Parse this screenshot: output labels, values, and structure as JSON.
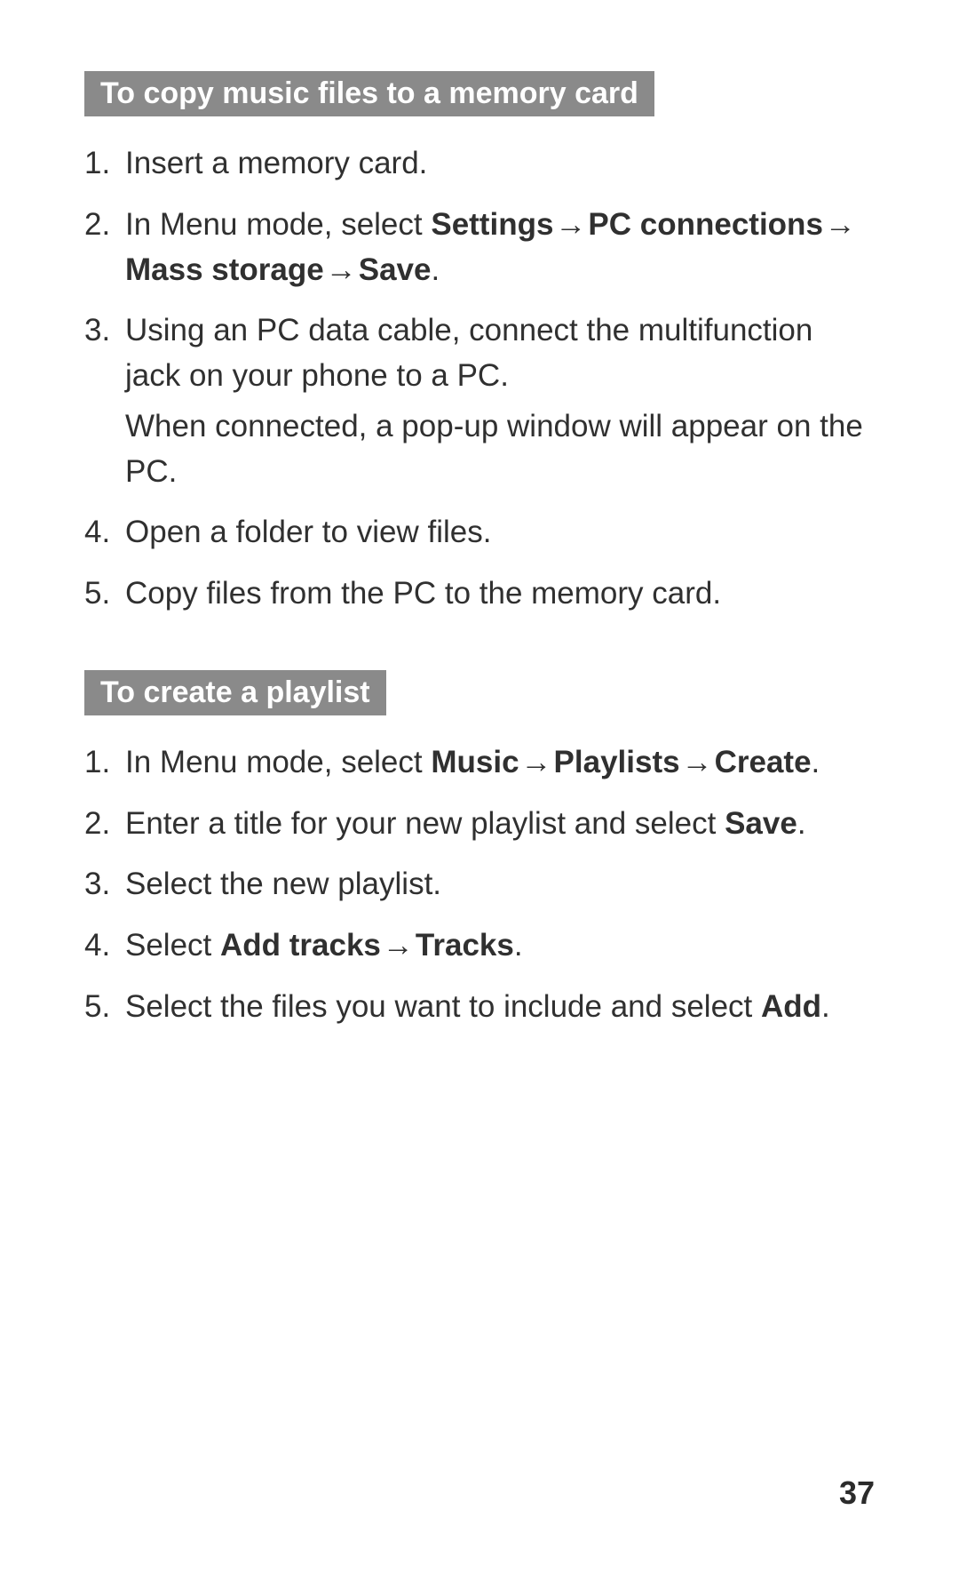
{
  "sections": [
    {
      "heading": "To copy music files to a memory card",
      "steps": [
        {
          "runs": [
            {
              "t": "Insert a memory card."
            }
          ]
        },
        {
          "runs": [
            {
              "t": "In Menu mode, select "
            },
            {
              "t": "Settings",
              "b": true
            },
            {
              "t": " → ",
              "b": true,
              "arrow": true
            },
            {
              "t": "PC connections",
              "b": true
            },
            {
              "t": " → ",
              "b": true,
              "arrow": true
            },
            {
              "t": "Mass storage",
              "b": true
            },
            {
              "t": " → ",
              "b": true,
              "arrow": true
            },
            {
              "t": "Save",
              "b": true
            },
            {
              "t": "."
            }
          ]
        },
        {
          "runs": [
            {
              "t": "Using an PC data cable, connect the multifunction jack on your phone to a PC."
            }
          ],
          "sub_runs": [
            {
              "t": "When connected, a pop-up window will appear on the PC."
            }
          ]
        },
        {
          "runs": [
            {
              "t": "Open a folder to view files."
            }
          ]
        },
        {
          "runs": [
            {
              "t": "Copy files from the PC to the memory card."
            }
          ]
        }
      ]
    },
    {
      "heading": "To create a playlist",
      "steps": [
        {
          "runs": [
            {
              "t": "In Menu mode, select "
            },
            {
              "t": "Music",
              "b": true
            },
            {
              "t": " → ",
              "b": true,
              "arrow": true
            },
            {
              "t": "Playlists",
              "b": true
            },
            {
              "t": " → ",
              "b": true,
              "arrow": true
            },
            {
              "t": "Create",
              "b": true
            },
            {
              "t": "."
            }
          ]
        },
        {
          "runs": [
            {
              "t": "Enter a title for your new playlist and select "
            },
            {
              "t": "Save",
              "b": true
            },
            {
              "t": "."
            }
          ]
        },
        {
          "runs": [
            {
              "t": "Select the new playlist."
            }
          ]
        },
        {
          "runs": [
            {
              "t": "Select "
            },
            {
              "t": "Add tracks",
              "b": true
            },
            {
              "t": " → ",
              "b": true,
              "arrow": true
            },
            {
              "t": "Tracks",
              "b": true
            },
            {
              "t": "."
            }
          ]
        },
        {
          "runs": [
            {
              "t": "Select the files you want to include and select "
            },
            {
              "t": "Add",
              "b": true
            },
            {
              "t": "."
            }
          ]
        }
      ]
    }
  ],
  "page_number": "37"
}
